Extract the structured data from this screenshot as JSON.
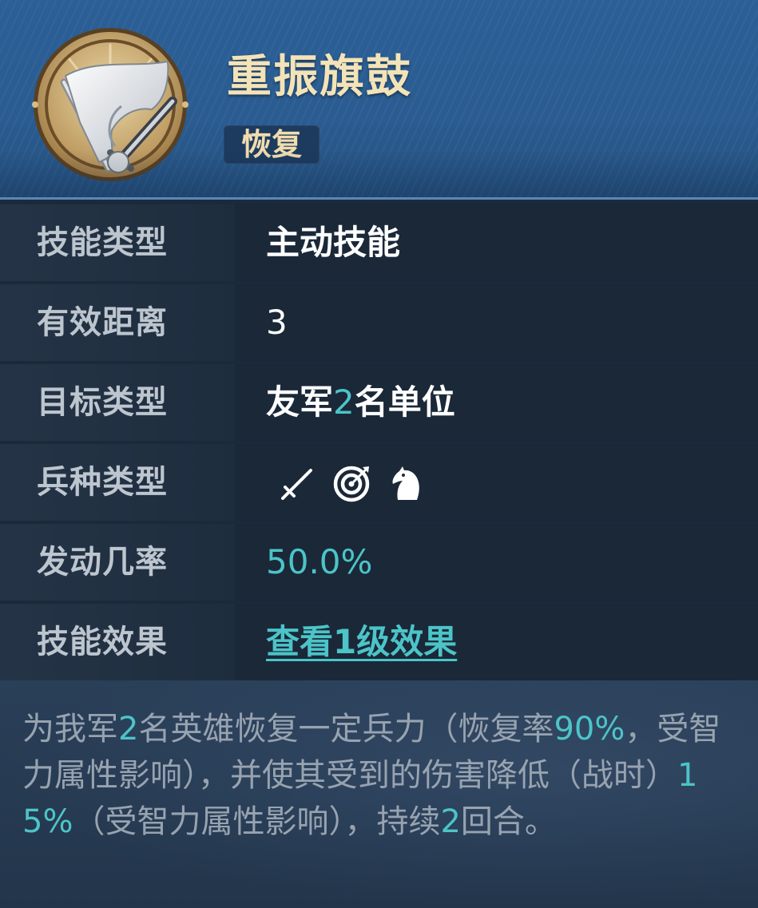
{
  "header": {
    "title": "重振旗鼓",
    "badge": "恢复",
    "icon": "flag-sword-icon"
  },
  "rows": [
    {
      "label": "技能类型",
      "value": "主动技能"
    },
    {
      "label": "有效距离",
      "value": "3"
    },
    {
      "label": "目标类型",
      "value_parts": [
        "友军",
        "2",
        "名单位"
      ]
    },
    {
      "label": "兵种类型",
      "icons": [
        "sword-icon",
        "target-icon",
        "horse-icon"
      ]
    },
    {
      "label": "发动几率",
      "value": "50.0%"
    },
    {
      "label": "技能效果",
      "link": "查看1级效果"
    }
  ],
  "description": {
    "parts": [
      "为我军",
      "2",
      "名英雄恢复一定兵力（恢复率",
      "90%",
      "，受智力属性影响），并使其受到的伤害降低（战时）",
      "15%",
      "（受智力属性影响），持续",
      "2",
      "回合。"
    ]
  },
  "colors": {
    "accent": "#4cc4c8",
    "title": "#f3e3b8",
    "header_bg": "#2b5f96",
    "row_bg": "#1a2838"
  }
}
